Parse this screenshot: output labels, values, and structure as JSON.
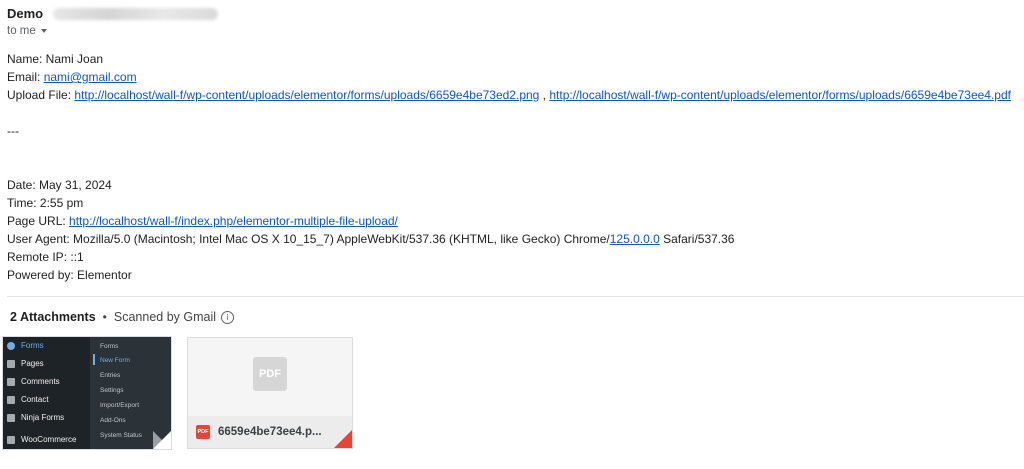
{
  "email": {
    "sender_name": "Demo",
    "recipient": "to me"
  },
  "fields": {
    "name": "Name: Nami Joan",
    "email_label": "Email: ",
    "email_value": "nami@gmail.com",
    "upload_label": "Upload File: ",
    "upload_link1": "http://localhost/wall-f/wp-content/uploads/elementor/forms/uploads/6659e4be73ed2.png",
    "upload_sep": " , ",
    "upload_link2": "http://localhost/wall-f/wp-content/uploads/elementor/forms/uploads/6659e4be73ee4.pdf",
    "separator": "---",
    "date": "Date: May 31, 2024",
    "time": "Time: 2:55 pm",
    "page_url_label": "Page URL: ",
    "page_url": "http://localhost/wall-f/index.php/elementor-multiple-file-upload/",
    "user_agent_prefix": "User Agent: Mozilla/5.0 (Macintosh; Intel Mac OS X 10_15_7) AppleWebKit/537.36 (KHTML, like Gecko) Chrome/",
    "user_agent_link": "125.0.0.0",
    "user_agent_suffix": " Safari/537.36",
    "remote_ip": "Remote IP: ::1",
    "powered_by": "Powered by: Elementor"
  },
  "attachments": {
    "count_label": "2 Attachments",
    "dot": "•",
    "scanned": "Scanned by Gmail",
    "info_glyph": "i",
    "thumb1": {
      "menu": [
        "Forms",
        "Pages",
        "Comments",
        "Contact",
        "Ninja Forms",
        "WooCommerce"
      ],
      "submenu": [
        "Forms",
        "New Form",
        "Entries",
        "Settings",
        "Import/Export",
        "Add-Ons",
        "System Status"
      ]
    },
    "thumb2": {
      "big_label": "PDF",
      "small_label": "PDF",
      "file_name": "6659e4be73ee4.p..."
    }
  }
}
